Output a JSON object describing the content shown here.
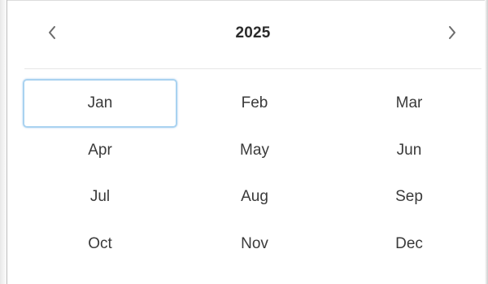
{
  "calendar": {
    "year": "2025",
    "prev_icon": "chevron-left-icon",
    "next_icon": "chevron-right-icon",
    "months": [
      "Jan",
      "Feb",
      "Mar",
      "Apr",
      "May",
      "Jun",
      "Jul",
      "Aug",
      "Sep",
      "Oct",
      "Nov",
      "Dec"
    ],
    "selected_month": "Jan",
    "colors": {
      "selected_border": "#a9d2f0",
      "text": "#3a3a3a",
      "year_text": "#2b2b2b",
      "chevron": "#6b6b6b"
    }
  }
}
